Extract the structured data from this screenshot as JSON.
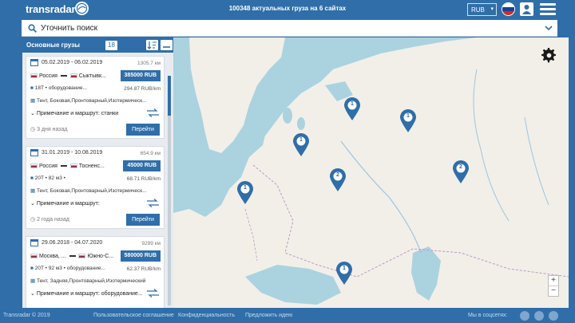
{
  "header": {
    "logo": "transradar",
    "tagline": "100348 актуальных груза на 6 сайтах",
    "currency": "RUB"
  },
  "search": {
    "label": "Уточнить поиск"
  },
  "panel": {
    "title": "Основные грузы",
    "count": "18"
  },
  "cards": [
    {
      "date": "05.02.2019 - 06.02.2019",
      "distance": "1305.7 км",
      "from": "Россия",
      "to": "Сыктывк...",
      "price": "385000 RUB",
      "specs": "18T • оборудование...",
      "rate": "294.87 RUB/km",
      "body": "Тент, Боковая,Пронтоварный,Изотермическ...",
      "note": "Примечание и маршрут: станки",
      "ago": "3 дня назад",
      "button": "Перейти"
    },
    {
      "date": "31.01.2019 - 10.08.2019",
      "distance": "654.9 км",
      "from": "Россия",
      "to": "Тосненс...",
      "price": "45000 RUB",
      "specs": "20T • 82 м3 •",
      "rate": "68.71 RUB/km",
      "body": "Тент, Боковая,Пронтоварный,Изотермическ...",
      "note": "Примечание и маршрут:",
      "ago": "2 года назад",
      "button": "Перейти"
    },
    {
      "date": "29.06.2018 - 04.07.2020",
      "distance": "9299 км",
      "from": "Москва, ...",
      "to": "Южно-С...",
      "price": "580000 RUB",
      "specs": "20T • 92 м3 • оборудование...",
      "rate": "62.37 RUB/km",
      "body": "Тент, Задняя,Пронтоварный,Изотермический",
      "note": "Примечание и маршрут: оборудование...",
      "ago": "",
      "button": ""
    }
  ],
  "markers": [
    "1",
    "1",
    "1",
    "2",
    "2",
    "1",
    "1"
  ],
  "footer": {
    "copyright": "Transradar © 2019",
    "links": [
      "Пользовательское соглашение",
      "Конфиденциальность",
      "Предложить идею"
    ],
    "social_label": "Мы в соцсетях:"
  },
  "colors": {
    "primary": "#2f6ea9",
    "water": "#aad3df",
    "land": "#f2efe9"
  },
  "icons": {
    "search": "search-icon",
    "chevron": "chevron-down-icon",
    "settings": "gear-icon",
    "menu": "hamburger-icon",
    "user": "user-icon"
  }
}
